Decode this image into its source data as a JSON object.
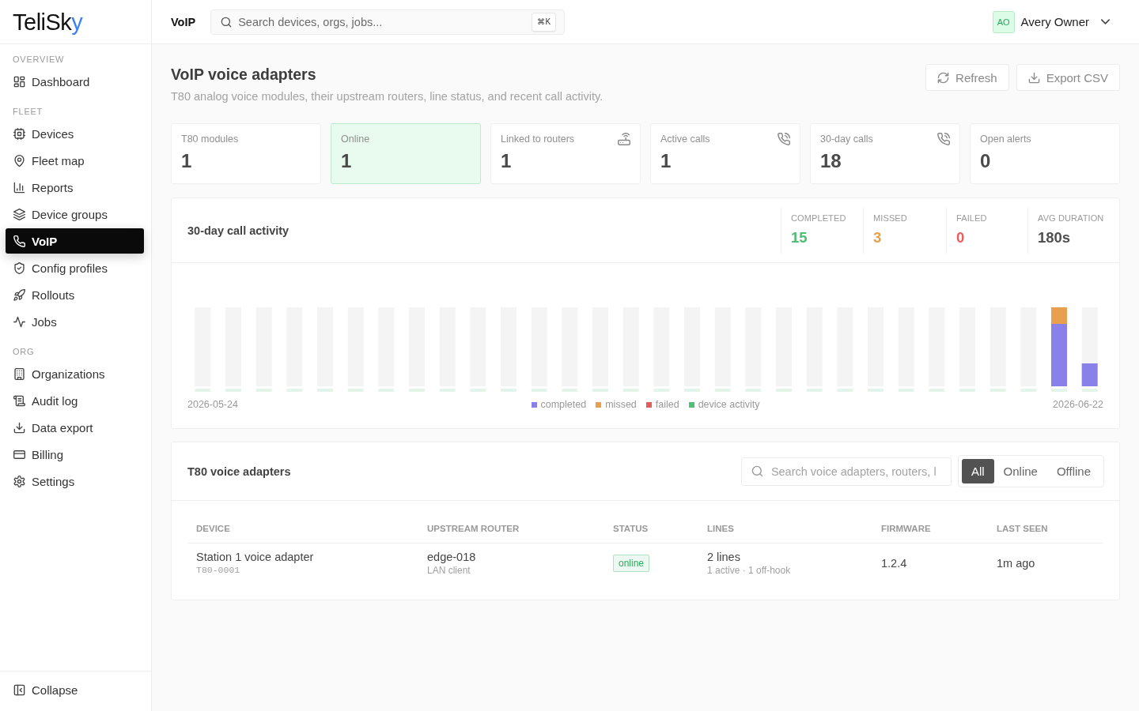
{
  "sidebar": {
    "logo": {
      "text": "TeliSk",
      "accent": "y"
    },
    "sections": [
      {
        "label": "OVERVIEW",
        "items": [
          {
            "label": "Dashboard",
            "selected": false
          }
        ]
      },
      {
        "label": "FLEET",
        "items": [
          {
            "label": "Devices",
            "selected": false
          },
          {
            "label": "Fleet map",
            "selected": false
          },
          {
            "label": "Reports",
            "selected": false
          },
          {
            "label": "Device groups",
            "selected": false
          },
          {
            "label": "VoIP",
            "selected": true
          },
          {
            "label": "Config profiles",
            "selected": false
          },
          {
            "label": "Rollouts",
            "selected": false
          },
          {
            "label": "Jobs",
            "selected": false
          }
        ]
      },
      {
        "label": "ORG",
        "items": [
          {
            "label": "Organizations",
            "selected": false
          },
          {
            "label": "Audit log",
            "selected": false
          },
          {
            "label": "Data export",
            "selected": false
          },
          {
            "label": "Billing",
            "selected": false
          },
          {
            "label": "Settings",
            "selected": false
          }
        ]
      }
    ],
    "footer": {
      "label": "Collapse"
    }
  },
  "header": {
    "title": "VoIP",
    "search": {
      "placeholder": "Search devices, orgs, jobs...",
      "shortcut": "⌘K"
    },
    "user": {
      "initials": "AO",
      "name": "Avery Owner"
    }
  },
  "page": {
    "title": "VoIP voice adapters",
    "subtitle": "T80 analog voice modules, their upstream routers, line status, and recent call activity.",
    "actions": [
      "Refresh",
      "Export CSV"
    ]
  },
  "stats": [
    {
      "label": "T80 modules",
      "value": "1",
      "highlighted": false
    },
    {
      "label": "Online",
      "value": "1",
      "highlighted": true
    },
    {
      "label": "Linked to routers",
      "value": "1",
      "highlighted": false
    },
    {
      "label": "Active calls",
      "value": "1",
      "highlighted": false
    },
    {
      "label": "30-day calls",
      "value": "18",
      "highlighted": false
    },
    {
      "label": "Open alerts",
      "value": "0",
      "highlighted": false
    }
  ],
  "activity": {
    "title": "30-day call activity",
    "summary": [
      {
        "label": "COMPLETED",
        "value": "15",
        "color": "#4cbf72"
      },
      {
        "label": "MISSED",
        "value": "3",
        "color": "#e8a04e"
      },
      {
        "label": "FAILED",
        "value": "0",
        "color": "#e85c5c"
      },
      {
        "label": "AVG DURATION",
        "value": "180s",
        "color": "#505050"
      }
    ],
    "range": {
      "start": "2026-05-24",
      "end": "2026-06-22"
    },
    "legend": [
      {
        "label": "completed",
        "color": "#8a80ea"
      },
      {
        "label": "missed",
        "color": "#e8a04e"
      },
      {
        "label": "failed",
        "color": "#e35d5d"
      },
      {
        "label": "device activity",
        "color": "#4fc07a"
      }
    ]
  },
  "adapters": {
    "title": "T80 voice adapters",
    "search": {
      "placeholder": "Search voice adapters, routers, l"
    },
    "filters": [
      {
        "label": "All",
        "selected": true
      },
      {
        "label": "Online",
        "selected": false
      },
      {
        "label": "Offline",
        "selected": false
      }
    ],
    "table": {
      "columns": [
        "DEVICE",
        "UPSTREAM ROUTER",
        "STATUS",
        "LINES",
        "FIRMWARE",
        "LAST SEEN"
      ],
      "rows": [
        {
          "device": {
            "name": "Station 1 voice adapter",
            "serial": "T80-0001"
          },
          "router": {
            "name": "edge-018",
            "detail": "LAN client"
          },
          "status": {
            "label": "online",
            "color": "#2fae5f"
          },
          "lines": {
            "summary": "2 lines",
            "detail": "1 active · 1 off-hook"
          },
          "firmware": "1.2.4",
          "last_seen": "1m ago"
        }
      ]
    }
  }
}
